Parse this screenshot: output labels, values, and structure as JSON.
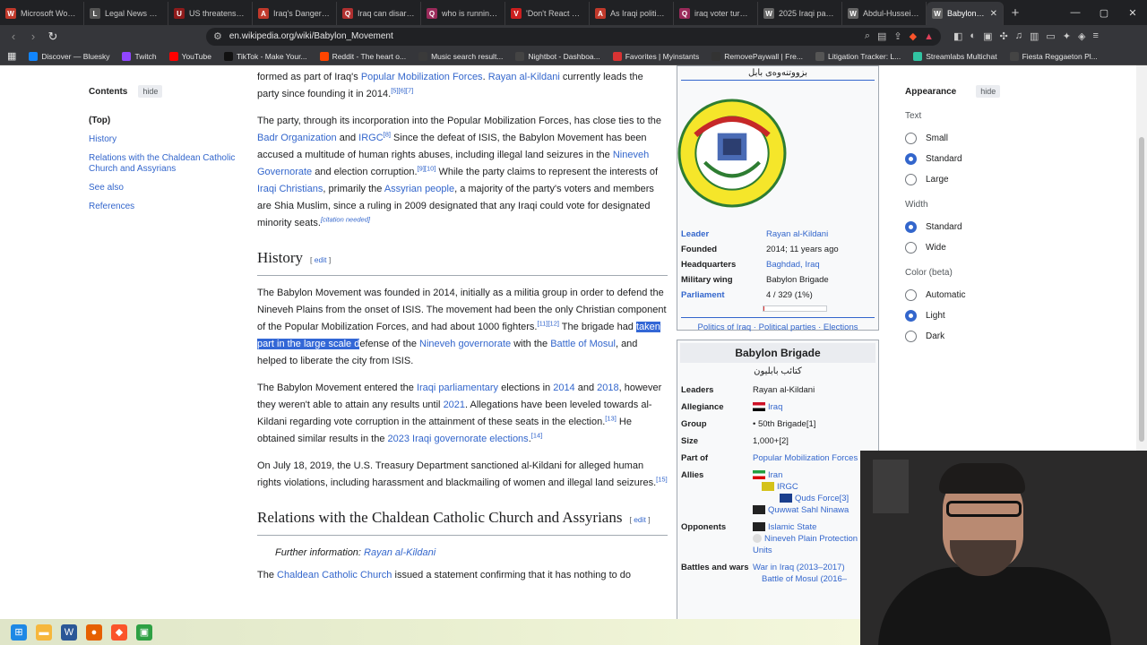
{
  "browser": {
    "tabs": [
      {
        "title": "Microsoft Word -",
        "fav": "W",
        "color": "#c0392b"
      },
      {
        "title": "Legal News & An",
        "fav": "L",
        "color": "#555555"
      },
      {
        "title": "US threatens iraq",
        "fav": "U",
        "color": "#8e1b1b"
      },
      {
        "title": "Iraq's Dangerous",
        "fav": "A",
        "color": "#c0392b"
      },
      {
        "title": "Iraq can disarm fa",
        "fav": "Q",
        "color": "#b03030"
      },
      {
        "title": "who is running fo",
        "fav": "Q",
        "color": "#9a2a5a"
      },
      {
        "title": "'Don't React Whe",
        "fav": "V",
        "color": "#cc1f1f"
      },
      {
        "title": "As Iraqi politician",
        "fav": "A",
        "color": "#c0392b"
      },
      {
        "title": "iraq voter turnou",
        "fav": "Q",
        "color": "#9a2a5a"
      },
      {
        "title": "2025 Iraqi parliam",
        "fav": "W",
        "color": "#666666"
      },
      {
        "title": "Abdul-Hussein Al-",
        "fav": "W",
        "color": "#666666"
      },
      {
        "title": "Babylon Mov",
        "fav": "W",
        "color": "#666666",
        "active": true
      }
    ],
    "new_tab": "+",
    "url": "en.wikipedia.org/wiki/Babylon_Movement",
    "bookmarks": [
      {
        "label": "Discover — Bluesky",
        "color": "#1185fe"
      },
      {
        "label": "Twitch",
        "color": "#9146ff"
      },
      {
        "label": "YouTube",
        "color": "#ff0000"
      },
      {
        "label": "TikTok - Make Your...",
        "color": "#111111"
      },
      {
        "label": "Reddit - The heart o...",
        "color": "#ff4500"
      },
      {
        "label": "Music search result...",
        "color": "#3a3a3a"
      },
      {
        "label": "Nightbot - Dashboa...",
        "color": "#444444"
      },
      {
        "label": "Favorites | Myinstants",
        "color": "#d83333"
      },
      {
        "label": "RemovePaywall | Fre...",
        "color": "#333333"
      },
      {
        "label": "Litigation Tracker: L...",
        "color": "#555555"
      },
      {
        "label": "Streamlabs Multichat",
        "color": "#31c3a2"
      },
      {
        "label": "Fiesta Reggaeton Pl...",
        "color": "#444444"
      }
    ]
  },
  "toc": {
    "title": "Contents",
    "hide": "hide",
    "items": [
      "(Top)",
      "History",
      "Relations with the Chaldean Catholic Church and Assyrians",
      "See also",
      "References"
    ]
  },
  "article": {
    "p0": {
      "t1": "formed as part of Iraq's ",
      "l1": "Popular Mobilization Forces",
      "t2": ". ",
      "l2": "Rayan al-Kildani",
      "t3": " currently leads the party since founding it in 2014.",
      "ref": "[5][6][7]"
    },
    "p1": {
      "t1": "The party, through its incorporation into the Popular Mobilization Forces, has close ties to the ",
      "l1": "Badr Organization",
      "t2": " and ",
      "l2": "IRGC",
      "r1": "[8]",
      "t3": " Since the defeat of ISIS, the Babylon Movement has been accused a multitude of human rights abuses, including illegal land seizures in the ",
      "l3": "Nineveh Governorate",
      "t4": " and election corruption.",
      "r2": "[9][10]",
      "t5": " While the party claims to represent the interests of ",
      "l4": "Iraqi Christians",
      "t6": ", primarily the ",
      "l5": "Assyrian people",
      "t7": ", a majority of the party's voters and members are Shia Muslim, since a ruling in 2009 designated that any Iraqi could vote for designated minority seats.",
      "cn": "[citation needed]"
    },
    "h_history": "History",
    "edit": "edit",
    "p2": {
      "t1": "The Babylon Movement was founded in 2014, initially as a militia group in order to defend the Nineveh Plains from the onset of ISIS. The movement had been the only Christian component of the Popular Mobilization Forces, and had about 1000 fighters.",
      "r1": "[11][12]",
      "t2": " The brigade had ",
      "hl": "taken part in the large scale d",
      "t3": "efense of the ",
      "l1": "Nineveh governorate",
      "t4": " with the ",
      "l2": "Battle of Mosul",
      "t5": ", and helped to liberate the city from ISIS."
    },
    "p3": {
      "t1": "The Babylon Movement entered the ",
      "l1": "Iraqi parliamentary",
      "t2": " elections in ",
      "l2": "2014",
      "t3": " and ",
      "l3": "2018",
      "t4": ", however they weren't able to attain any results until ",
      "l4": "2021",
      "t5": ". Allegations have been leveled towards al-Kildani regarding vote corruption in the attainment of these seats in the election.",
      "r1": "[13]",
      "t6": " He obtained similar results in the ",
      "l5": "2023 Iraqi governorate elections",
      "t7": ".",
      "r2": "[14]"
    },
    "p4": {
      "t1": "On July 18, 2019, the U.S. Treasury Department sanctioned al-Kildani for alleged human rights violations, including harassment and blackmailing of women and illegal land seizures.",
      "r1": "[15]"
    },
    "h_relations": "Relations with the Chaldean Catholic Church and Assyrians",
    "hatnote_label": "Further information: ",
    "hatnote_link": "Rayan al-Kildani",
    "p5": {
      "t1": "The ",
      "l1": "Chaldean Catholic Church",
      "t2": " issued a statement confirming that it has nothing to do"
    }
  },
  "infobox1": {
    "native_name": "بزووتنەوەی بابل",
    "rows": [
      {
        "k": "Leader",
        "v": "Rayan al-Kildani",
        "klink": true,
        "vlink": true
      },
      {
        "k": "Founded",
        "v": "2014; 11 years ago"
      },
      {
        "k": "Headquarters",
        "v": "Baghdad, Iraq",
        "vlink": true
      },
      {
        "k": "Military wing",
        "v": "Babylon Brigade"
      },
      {
        "k": "Parliament",
        "v": "4 / 329   (1%)",
        "klink": true
      }
    ],
    "parliament_seats": 4,
    "parliament_total": 329,
    "footer": "Politics of Iraq · Political parties · Elections"
  },
  "infobox2": {
    "title": "Babylon Brigade",
    "native_name": "كتائب بابليون",
    "rows": [
      {
        "k": "Leaders",
        "lines": [
          "Rayan al-Kildani"
        ]
      },
      {
        "k": "Allegiance",
        "lines": [
          "Iraq"
        ]
      },
      {
        "k": "Group",
        "lines": [
          "• 50th Brigade[1]"
        ]
      },
      {
        "k": "Size",
        "lines": [
          "1,000+[2]"
        ]
      },
      {
        "k": "Part of",
        "lines": [
          "Popular Mobilization Forces"
        ]
      },
      {
        "k": "Allies",
        "lines": [
          "Iran",
          "IRGC",
          "Quds Force[3]",
          "Quwwat Sahl Ninawa"
        ]
      },
      {
        "k": "Opponents",
        "lines": [
          "Islamic State",
          "Nineveh Plain Protection Units"
        ]
      },
      {
        "k": "Battles and wars",
        "lines": [
          "War in Iraq (2013–2017)",
          "Battle of Mosul (2016–"
        ]
      }
    ]
  },
  "appearance": {
    "title": "Appearance",
    "hide": "hide",
    "text_label": "Text",
    "text_options": [
      "Small",
      "Standard",
      "Large"
    ],
    "text_selected": "Standard",
    "width_label": "Width",
    "width_options": [
      "Standard",
      "Wide"
    ],
    "width_selected": "Standard",
    "color_label": "Color (beta)",
    "color_options": [
      "Automatic",
      "Light",
      "Dark"
    ],
    "color_selected": "Light"
  },
  "colors": {
    "link": "#3366cc",
    "selection": "#3367d6",
    "chrome": "#35363a"
  }
}
